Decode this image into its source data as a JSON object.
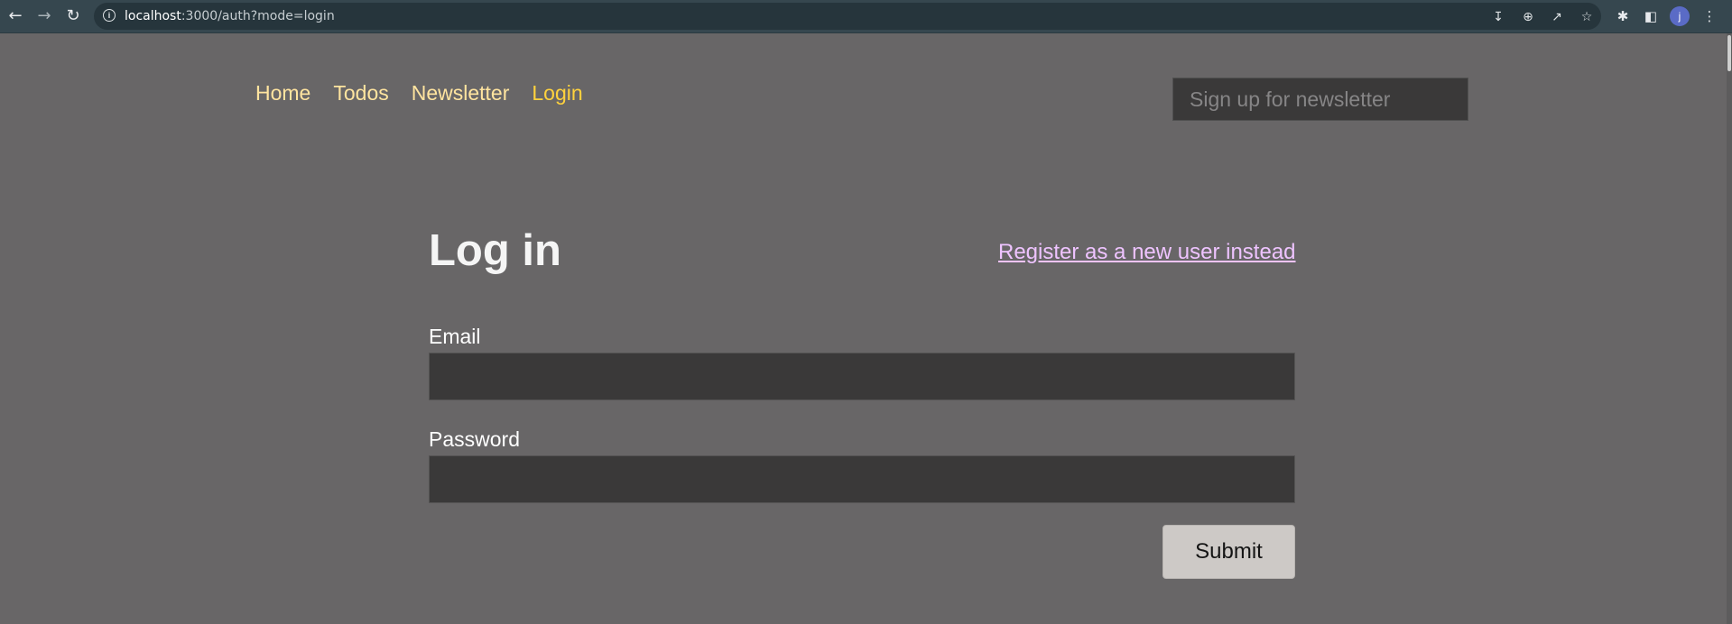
{
  "browser": {
    "url_host": "localhost",
    "url_rest": ":3000/auth?mode=login",
    "avatar_initial": "j",
    "icons": [
      "back-arrow-icon",
      "forward-arrow-icon",
      "reload-icon",
      "info-icon",
      "install-icon",
      "zoom-icon",
      "share-icon",
      "star-icon",
      "extensions-icon",
      "side-panel-icon",
      "menu-dots-icon"
    ]
  },
  "nav": {
    "home": "Home",
    "todos": "Todos",
    "newsletter": "Newsletter",
    "login": "Login",
    "active": "login",
    "link_color": "#ffe49f",
    "active_color": "#ffd23d"
  },
  "newsletter_signup": {
    "placeholder": "Sign up for newsletter",
    "value": ""
  },
  "form": {
    "title": "Log in",
    "switch_link": "Register as a new user instead",
    "email_label": "Email",
    "email_value": "",
    "password_label": "Password",
    "password_value": "",
    "submit_label": "Submit"
  },
  "colors": {
    "page_bg": "#686667",
    "input_bg": "#3a3939",
    "register_link": "#eec3ff",
    "button_bg": "#cdc9c6"
  }
}
